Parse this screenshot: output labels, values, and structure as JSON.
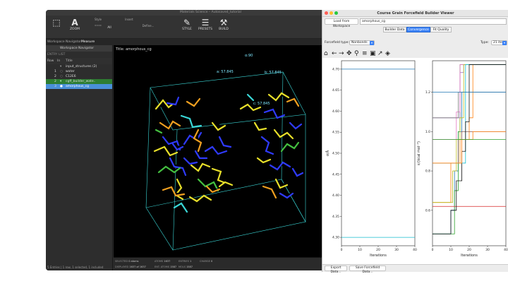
{
  "maestro": {
    "title": "Materials Science – Autosaved_tutorial",
    "toolbar": {
      "zoom_label": "ZOOM",
      "style_label": "Style",
      "atoms_label": "All",
      "insert_label": "Insert",
      "define_label": "Define...",
      "styles_label": "STYLE",
      "presets_label": "PRESETS",
      "build_label": "BUILD"
    },
    "tabs": [
      "Workspace Navigator",
      "Measure"
    ],
    "navigator": {
      "header": "Workspace Navigator",
      "filter": "ENTRY LIST",
      "col_row": "Row",
      "col_in": "In",
      "col_title": "Title",
      "rows": [
        {
          "row": "",
          "title": "input_structures (2)"
        },
        {
          "row": "1",
          "title": "water"
        },
        {
          "row": "2",
          "title": "C12E6"
        },
        {
          "row": "2",
          "title": "cgff_builder_wate.."
        },
        {
          "row": "3",
          "title": "amorphous_cg"
        }
      ],
      "status": "5 Entries | 1 row, 1 selected, 1 included"
    },
    "viewport": {
      "title": "Title: amorphous_cg",
      "label_a": "a: 57.845",
      "label_b": "b: 57.845",
      "label_c": "c: 57.845",
      "label_angle": "α:90",
      "status": {
        "selected_label": "SELECTED",
        "selected_value": "0 atoms",
        "displayed_label": "DISPLAYED",
        "displayed_value": "1637 of 1637",
        "atoms_label": "ATOMS",
        "atoms_value": "1637",
        "entries_label": "ENTRIES",
        "entries_value": "1",
        "charge_label": "CHARGE",
        "charge_value": "0",
        "ent_label": "ENT. ATOMS",
        "ent_value": "1587",
        "mols_label": "MOLS",
        "mols_value": "1587"
      }
    }
  },
  "viewer": {
    "title": "Course Grain Forcefield Builder Viewer",
    "load_button": "Load from Workspace",
    "entry_value": "amorphous_cg",
    "tabs": [
      "Builder Data",
      "Convergence",
      "Fit Quality"
    ],
    "selected_tab": "Convergence",
    "forcefield_label": "Forcefield type:",
    "forcefield_value": "Nonbonds",
    "type_label": "Type:",
    "type_value": "21 item",
    "export_button": "Export Data...",
    "save_button": "Save Forcefield Data...",
    "accent": "#3b82f6"
  },
  "chart_data": [
    {
      "type": "line",
      "xlabel": "Iterations",
      "ylabel": "σ/Å",
      "xlim": [
        0,
        40
      ],
      "ylim": [
        4.28,
        4.72
      ],
      "xticks": [
        0,
        10,
        20,
        30,
        40
      ],
      "yticks": [
        4.3,
        4.35,
        4.4,
        4.45,
        4.5,
        4.55,
        4.6,
        4.65,
        4.7
      ],
      "series": [
        {
          "color": "#1f77b4",
          "x": [
            0,
            40
          ],
          "y": [
            4.7,
            4.7
          ]
        },
        {
          "color": "#17becf",
          "x": [
            0,
            40
          ],
          "y": [
            4.3,
            4.3
          ]
        }
      ]
    },
    {
      "type": "line",
      "xlabel": "Iterations",
      "ylabel": "ε/(kcal mol⁻¹)",
      "xlim": [
        0,
        40
      ],
      "ylim": [
        0.42,
        1.36
      ],
      "xticks": [
        0,
        10,
        20,
        30,
        40
      ],
      "yticks": [
        0.6,
        0.8,
        1.0,
        1.2
      ],
      "series": [
        {
          "color": "#1f77b4",
          "x": [
            0,
            8,
            10,
            12,
            14,
            16,
            40
          ],
          "y": [
            0.48,
            0.48,
            0.6,
            0.8,
            1.0,
            1.2,
            1.2
          ]
        },
        {
          "color": "#ff7f0e",
          "x": [
            0,
            5,
            10,
            15,
            20,
            22,
            40
          ],
          "y": [
            0.64,
            0.64,
            0.84,
            0.96,
            1.07,
            1.34,
            1.34
          ]
        },
        {
          "color": "#2ca02c",
          "x": [
            0,
            10,
            12,
            14,
            15,
            40
          ],
          "y": [
            0.48,
            0.48,
            0.7,
            1.0,
            1.34,
            1.34
          ]
        },
        {
          "color": "#d62728",
          "x": [
            0,
            12,
            14,
            40
          ],
          "y": [
            0.62,
            0.62,
            0.62,
            0.62
          ]
        },
        {
          "color": "#9467bd",
          "x": [
            0,
            13,
            15,
            17,
            40
          ],
          "y": [
            1.07,
            1.07,
            1.3,
            1.34,
            1.34
          ]
        },
        {
          "color": "#8c564b",
          "x": [
            0,
            10,
            14,
            16,
            40
          ],
          "y": [
            0.84,
            0.84,
            0.96,
            1.0,
            1.0
          ]
        },
        {
          "color": "#e377c2",
          "x": [
            0,
            11,
            13,
            15,
            40
          ],
          "y": [
            0.96,
            0.96,
            1.1,
            1.34,
            1.34
          ]
        },
        {
          "color": "#7f7f7f",
          "x": [
            0,
            12,
            14,
            40
          ],
          "y": [
            1.07,
            1.07,
            1.2,
            1.2
          ]
        },
        {
          "color": "#bcbd22",
          "x": [
            0,
            9,
            11,
            13,
            15,
            17,
            40
          ],
          "y": [
            0.64,
            0.64,
            0.8,
            0.96,
            1.07,
            1.34,
            1.34
          ]
        },
        {
          "color": "#17becf",
          "x": [
            0,
            14,
            18,
            40
          ],
          "y": [
            0.84,
            0.84,
            1.34,
            1.34
          ]
        },
        {
          "color": "#111111",
          "x": [
            0,
            8,
            10,
            13,
            16,
            18,
            20,
            40
          ],
          "y": [
            0.48,
            0.48,
            0.6,
            0.75,
            0.9,
            1.05,
            1.34,
            1.34
          ]
        },
        {
          "color": "#1f77b4",
          "x": [
            0,
            40
          ],
          "y": [
            1.2,
            1.2
          ]
        },
        {
          "color": "#ff7f0e",
          "x": [
            0,
            14,
            16,
            22,
            40
          ],
          "y": [
            0.84,
            0.84,
            0.96,
            1.0,
            1.0
          ]
        },
        {
          "color": "#2ca02c",
          "x": [
            0,
            40
          ],
          "y": [
            0.96,
            0.96
          ]
        }
      ]
    }
  ]
}
